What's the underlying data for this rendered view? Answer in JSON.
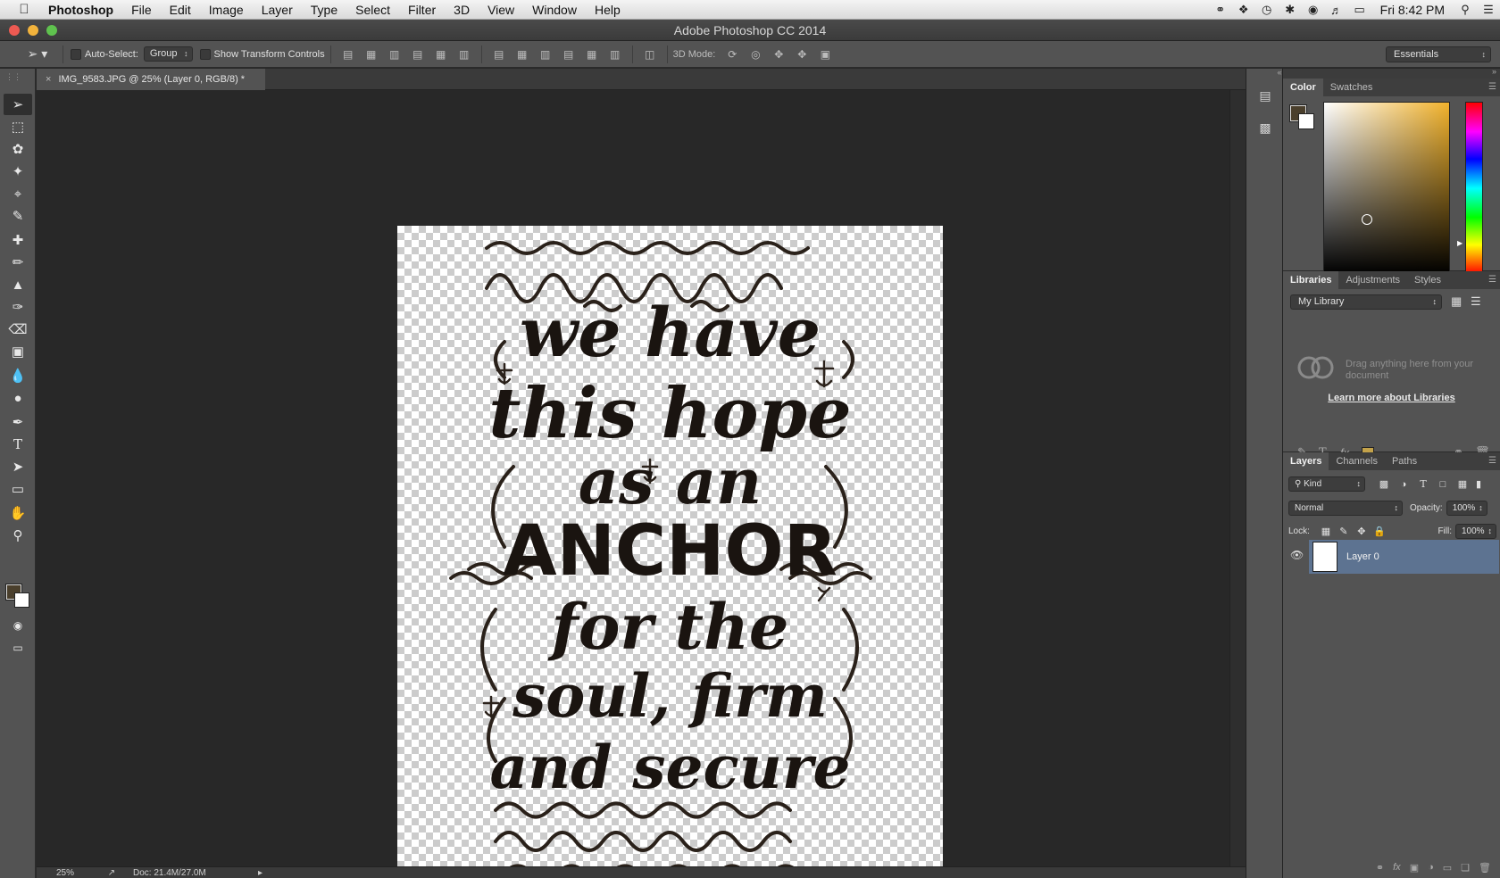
{
  "menubar": {
    "apple": "",
    "app": "Photoshop",
    "items": [
      "File",
      "Edit",
      "Image",
      "Layer",
      "Type",
      "Select",
      "Filter",
      "3D",
      "View",
      "Window",
      "Help"
    ],
    "clock": "Fri 8:42 PM"
  },
  "window": {
    "title": "Adobe Photoshop CC 2014"
  },
  "options": {
    "auto_select_label": "Auto-Select:",
    "auto_select_value": "Group",
    "transform_label": "Show Transform Controls",
    "mode_label": "3D Mode:",
    "workspace": "Essentials"
  },
  "document": {
    "tab_title": "IMG_9583.JPG @ 25% (Layer 0, RGB/8) *",
    "close": "×",
    "lettering": [
      "we have",
      "this hope",
      "as an",
      "ANCHOR",
      "for the",
      "soul, firm",
      "and secure"
    ]
  },
  "status": {
    "zoom": "25%",
    "doc": "Doc: 21.4M/27.0M"
  },
  "color_panel": {
    "tabs": [
      "Color",
      "Swatches"
    ],
    "fg": "#4a3f2c",
    "bg": "#ffffff"
  },
  "libraries": {
    "tabs": [
      "Libraries",
      "Adjustments",
      "Styles"
    ],
    "library": "My Library",
    "hint": "Drag anything here from your document",
    "link": "Learn more about Libraries"
  },
  "layers": {
    "tabs": [
      "Layers",
      "Channels",
      "Paths"
    ],
    "filter": "Kind",
    "blend": "Normal",
    "opacity_label": "Opacity:",
    "opacity": "100%",
    "lock_label": "Lock:",
    "fill_label": "Fill:",
    "fill": "100%",
    "items": [
      {
        "name": "Layer 0"
      }
    ]
  }
}
